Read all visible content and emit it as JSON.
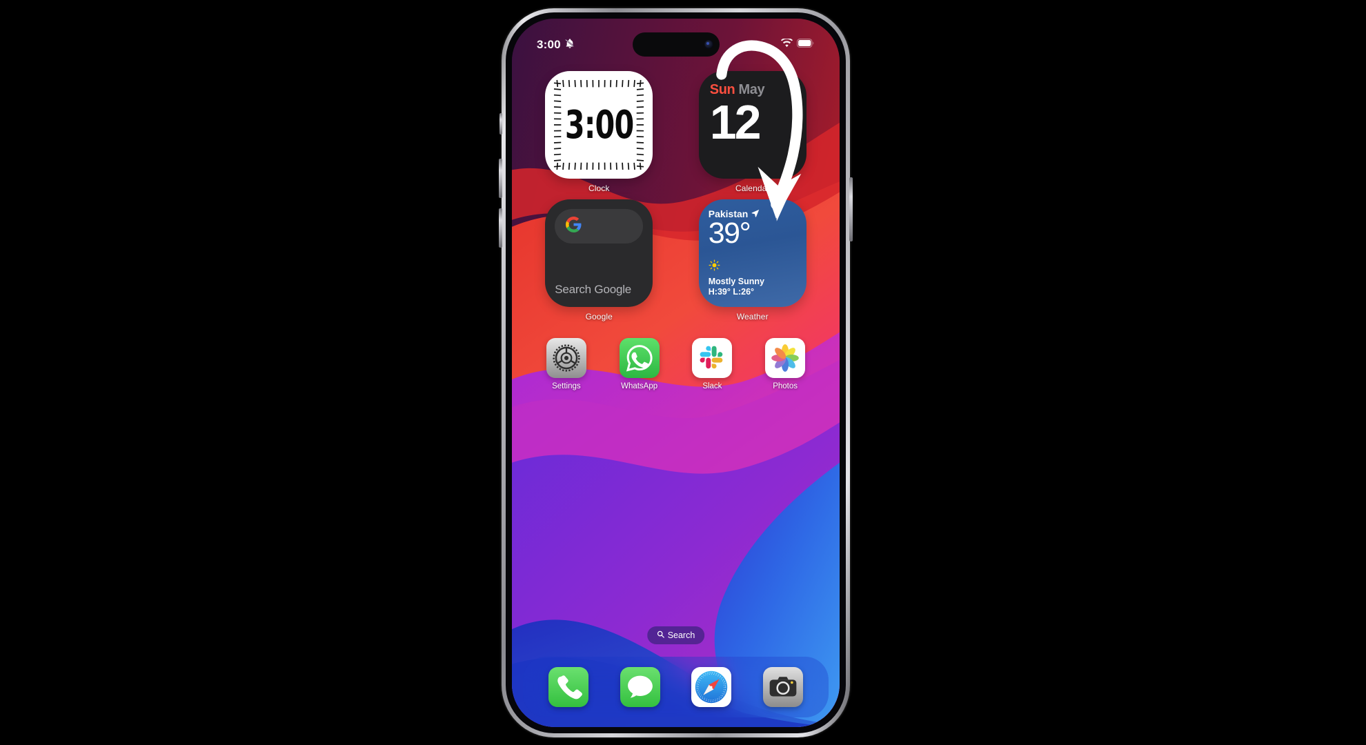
{
  "device": {
    "model_frame": "iphone-pro",
    "buttons": [
      "ringer-switch",
      "volume-up",
      "volume-down",
      "power"
    ]
  },
  "status_bar": {
    "time": "3:00",
    "silent_icon": "bell-slash-icon",
    "wifi_icon": "wifi-icon",
    "battery_icon": "battery-icon"
  },
  "widgets": [
    {
      "name": "Clock",
      "label": "Clock",
      "time": "3:00"
    },
    {
      "name": "Calendar",
      "label": "Calendar",
      "weekday": "Sun",
      "month": "May",
      "day": "12",
      "weekday_color": "#ff4f3f",
      "month_color": "#8e8e93"
    },
    {
      "name": "Google",
      "label": "Google",
      "search_placeholder": "Search Google",
      "logo_icon": "google-g-icon"
    },
    {
      "name": "Weather",
      "label": "Weather",
      "city": "Pakistan",
      "location_icon": "location-arrow-icon",
      "temperature": "39°",
      "condition_icon": "sun-icon",
      "condition": "Mostly Sunny",
      "high_low": "H:39° L:26°"
    }
  ],
  "apps": [
    {
      "label": "Settings",
      "icon": "settings-gears-icon"
    },
    {
      "label": "WhatsApp",
      "icon": "whatsapp-phone-icon"
    },
    {
      "label": "Slack",
      "icon": "slack-hash-icon"
    },
    {
      "label": "Photos",
      "icon": "photos-pinwheel-icon"
    }
  ],
  "search": {
    "label": "Search",
    "icon": "magnifier-icon"
  },
  "dock": [
    {
      "label": "Phone",
      "icon": "phone-handset-icon"
    },
    {
      "label": "Messages",
      "icon": "messages-bubble-icon"
    },
    {
      "label": "Safari",
      "icon": "safari-compass-icon"
    },
    {
      "label": "Camera",
      "icon": "camera-icon"
    }
  ],
  "annotation": {
    "type": "swipe-down-arrow",
    "color": "#ffffff"
  },
  "wallpaper": {
    "colors": [
      "#3a1140",
      "#c8232a",
      "#f0433b",
      "#f4366f",
      "#d12fa8",
      "#8a2ad0",
      "#5a2fd6",
      "#2f6fe0",
      "#1633c8"
    ]
  }
}
